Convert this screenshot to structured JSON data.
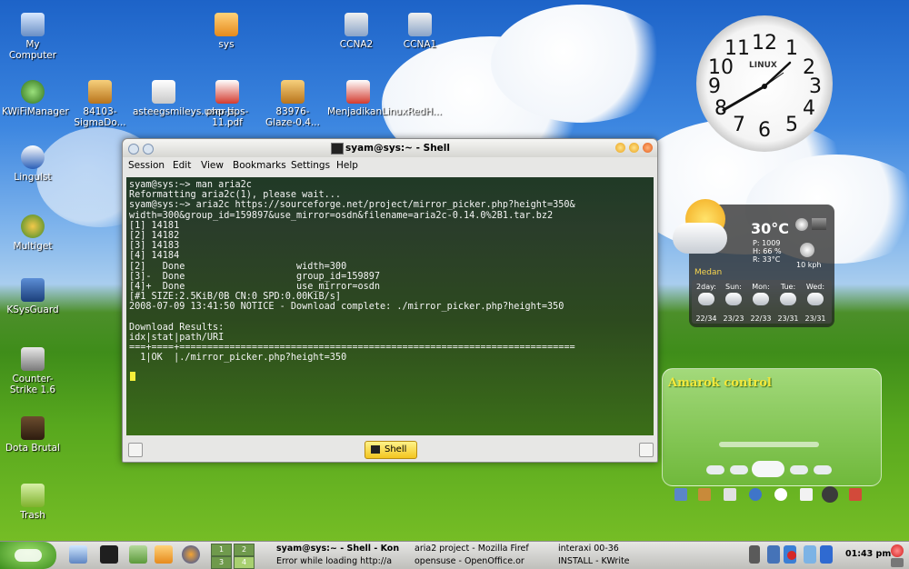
{
  "desktop_icons": [
    {
      "label": "My Computer",
      "icon": "computer-icon"
    },
    {
      "label": "sys",
      "icon": "folder-icon"
    },
    {
      "label": "CCNA2",
      "icon": "book-icon"
    },
    {
      "label": "CCNA1",
      "icon": "book-icon"
    },
    {
      "label": "KWiFiManager",
      "icon": "wifi-icon"
    },
    {
      "label": "84103-SigmaDo...",
      "icon": "archive-icon"
    },
    {
      "label": "asteegsmileys.user.js",
      "icon": "document-icon"
    },
    {
      "label": "php-tips-11.pdf",
      "icon": "pdf-icon"
    },
    {
      "label": "83976-Glaze-0.4...",
      "icon": "archive-icon"
    },
    {
      "label": "MenjadikanLinuxRedH...",
      "icon": "pdf-icon"
    },
    {
      "label": "Lingulst",
      "icon": "dictionary-icon"
    },
    {
      "label": "Multiget",
      "icon": "download-icon"
    },
    {
      "label": "KSysGuard",
      "icon": "monitor-icon"
    },
    {
      "label": "Counter-Strike 1.6",
      "icon": "game-icon"
    },
    {
      "label": "Dota Brutal",
      "icon": "game-icon"
    },
    {
      "label": "Trash",
      "icon": "trash-icon"
    }
  ],
  "clock": {
    "brand": "LINUX",
    "numbers": [
      "12",
      "1",
      "2",
      "3",
      "4",
      "5",
      "6",
      "7",
      "8",
      "9",
      "10",
      "11"
    ]
  },
  "weather": {
    "temp": "30°C",
    "pressure": "P: 1009",
    "humidity": "H: 66 %",
    "realfeel": "R: 33°C",
    "wind": "10 kph",
    "city": "Medan",
    "days": [
      {
        "name": "2day:",
        "temps": "22/34"
      },
      {
        "name": "Sun:",
        "temps": "23/23"
      },
      {
        "name": "Mon:",
        "temps": "22/33"
      },
      {
        "name": "Tue:",
        "temps": "23/31"
      },
      {
        "name": "Wed:",
        "temps": "23/31"
      }
    ]
  },
  "amarok": {
    "title": "Amarok control"
  },
  "konsole": {
    "title": "syam@sys:~ - Shell",
    "menu": [
      "Session",
      "Edit",
      "View",
      "Bookmarks",
      "Settings",
      "Help"
    ],
    "lines": [
      "syam@sys:~> man aria2c",
      "Reformatting aria2c(1), please wait...",
      "syam@sys:~> aria2c https://sourceforge.net/project/mirror_picker.php?height=350&",
      "width=300&group_id=159897&use_mirror=osdn&filename=aria2c-0.14.0%2B1.tar.bz2",
      "[1] 14181",
      "[2] 14182",
      "[3] 14183",
      "[4] 14184",
      "[2]   Done                    width=300",
      "[3]-  Done                    group_id=159897",
      "[4]+  Done                    use_mirror=osdn",
      "[#1 SIZE:2.5KiB/0B CN:0 SPD:0.00KiB/s]",
      "2008-07-09 13:41:50 NOTICE - Download complete: ./mirror_picker.php?height=350",
      "",
      "Download Results:",
      "idx|stat|path/URI",
      "===+====+=======================================================================",
      "  1|OK  |./mirror_picker.php?height=350"
    ],
    "tab_label": "Shell"
  },
  "taskbar": {
    "tasks": [
      {
        "label": "syam@sys:~ - Shell - Kon"
      },
      {
        "label": "aria2 project - Mozilla Firef"
      },
      {
        "label": "interaxi 00-36"
      },
      {
        "label": "Error while loading http://a"
      },
      {
        "label": "opensuse - OpenOffice.or"
      },
      {
        "label": "INSTALL - KWrite"
      }
    ],
    "pager": [
      "1",
      "2",
      "3",
      "4"
    ],
    "time": "01:43 pm"
  },
  "colors": {
    "accent": "#f7c63b",
    "terminal_text": "#f4f4f4",
    "cursor": "#f5ef3a"
  }
}
